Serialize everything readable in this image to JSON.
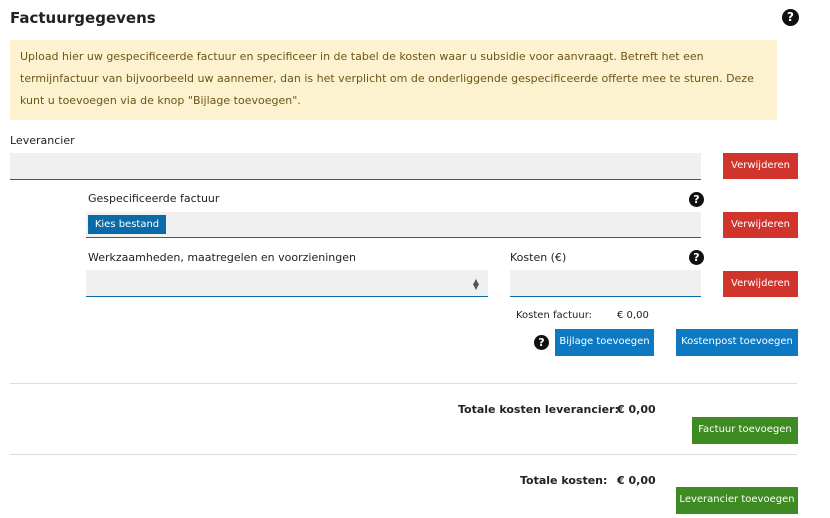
{
  "section": {
    "title": "Factuurgegevens",
    "help_icon": "?"
  },
  "notice": {
    "text": "Upload hier uw gespecificeerde factuur en specificeer in de tabel de kosten waar u subsidie voor aanvraagt. Betreft het een termijnfactuur van bijvoorbeeld uw aannemer, dan is het verplicht om de onderliggende gespecificeerde offerte mee te sturen. Deze kunt u toevoegen via de knop \"Bijlage toevoegen\"."
  },
  "leverancier": {
    "label": "Leverancier",
    "value": "",
    "remove_label": "Verwijderen"
  },
  "factuur": {
    "label": "Gespecificeerde factuur",
    "file_button": "Kies bestand",
    "remove_label": "Verwijderen"
  },
  "kostenpost": {
    "work_label": "Werkzaamheden, maatregelen en voorzieningen",
    "work_value": "",
    "cost_label": "Kosten (€)",
    "cost_value": "",
    "remove_label": "Verwijderen"
  },
  "totals": {
    "factuur_label": "Kosten factuur:",
    "factuur_value": "€ 0,00",
    "leverancier_label": "Totale kosten leverancier:",
    "leverancier_value": "€ 0,00",
    "total_label": "Totale kosten:",
    "total_value": "€ 0,00"
  },
  "actions": {
    "bijlage": "Bijlage toevoegen",
    "kostenpost": "Kostenpost toevoegen",
    "factuur": "Factuur toevoegen",
    "leverancier": "Leverancier toevoegen"
  },
  "colors": {
    "accent_blue": "#0c79c2",
    "danger_red": "#d0342c",
    "success_green": "#3e8a23",
    "notice_bg": "#fdf2d0"
  }
}
